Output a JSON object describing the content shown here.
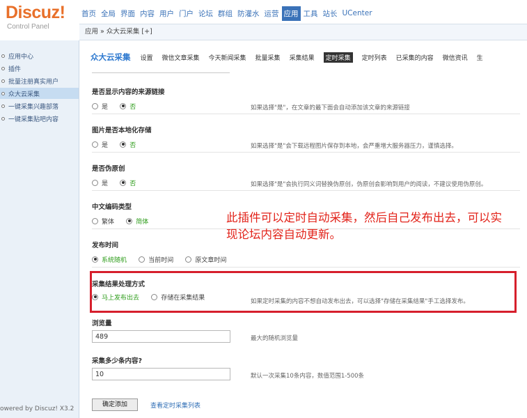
{
  "logo": {
    "brand": "Discuz!",
    "subtitle": "Control Panel"
  },
  "topnav": [
    "首页",
    "全局",
    "界面",
    "内容",
    "用户",
    "门户",
    "论坛",
    "群组",
    "防灌水",
    "运营",
    "应用",
    "工具",
    "站长",
    "UCenter"
  ],
  "topnav_active": "应用",
  "breadcrumb": "应用 » 众大云采集 [+]",
  "sidebar": {
    "items": [
      "应用中心",
      "插件",
      "批量注册真实用户",
      "众大云采集",
      "一键采集兴趣部落",
      "一键采集贴吧内容"
    ],
    "active": "众大云采集",
    "powered": "owered by Discuz! X3.2"
  },
  "subtabs": {
    "first": "众大云采集",
    "items": [
      "设置",
      "微信文章采集",
      "今天新闻采集",
      "批量采集",
      "采集结果",
      "定时采集",
      "定时列表",
      "已采集的内容",
      "微信资讯",
      "生"
    ],
    "active": "定时采集"
  },
  "form": {
    "source_link": {
      "title": "是否显示内容的来源链接",
      "options": [
        "是",
        "否"
      ],
      "selected": "否",
      "hint": "如果选择\"是\"，在文章的最下面会自动添加该文章的来源链接"
    },
    "localize_images": {
      "title": "图片是否本地化存储",
      "options": [
        "是",
        "否"
      ],
      "selected": "否",
      "hint": "如果选择\"是\"会下载远程图片保存到本地，会严重增大服务器压力，谨慎选择。"
    },
    "pseudo_original": {
      "title": "是否伪原创",
      "options": [
        "是",
        "否"
      ],
      "selected": "否",
      "hint": "如果选择\"是\"会执行同义词替换伪原创，伪原创会影响到用户的阅读，不建议使用伪原创。"
    },
    "encoding": {
      "title": "中文编码类型",
      "options": [
        "繁体",
        "简体"
      ],
      "selected": "简体"
    },
    "publish_time": {
      "title": "发布时间",
      "options": [
        "系统随机",
        "当前时间",
        "原文章时间"
      ],
      "selected": "系统随机"
    },
    "result_handling": {
      "title": "采集结果处理方式",
      "options": [
        "马上发布出去",
        "存储在采集结果"
      ],
      "selected": "马上发布出去",
      "hint": "如果定时采集的内容不想自动发布出去，可以选择\"存储在采集结果\"手工选择发布。"
    },
    "views": {
      "title": "浏览量",
      "value": "489",
      "hint": "最大的随机浏览量"
    },
    "count": {
      "title": "采集多少条内容?",
      "value": "10",
      "hint": "默认一次采集10条内容，数值范围1-500条"
    },
    "submit_label": "确定添加",
    "view_link_label": "查看定时采集列表"
  },
  "annotation": "此插件可以定时自动采集，然后自己发布出去，可以实现论坛内容自动更新。",
  "colors": {
    "accent": "#3a72b8",
    "brand": "#e8702a",
    "annotation": "#e2231a",
    "green_label": "#2f9d1c"
  }
}
